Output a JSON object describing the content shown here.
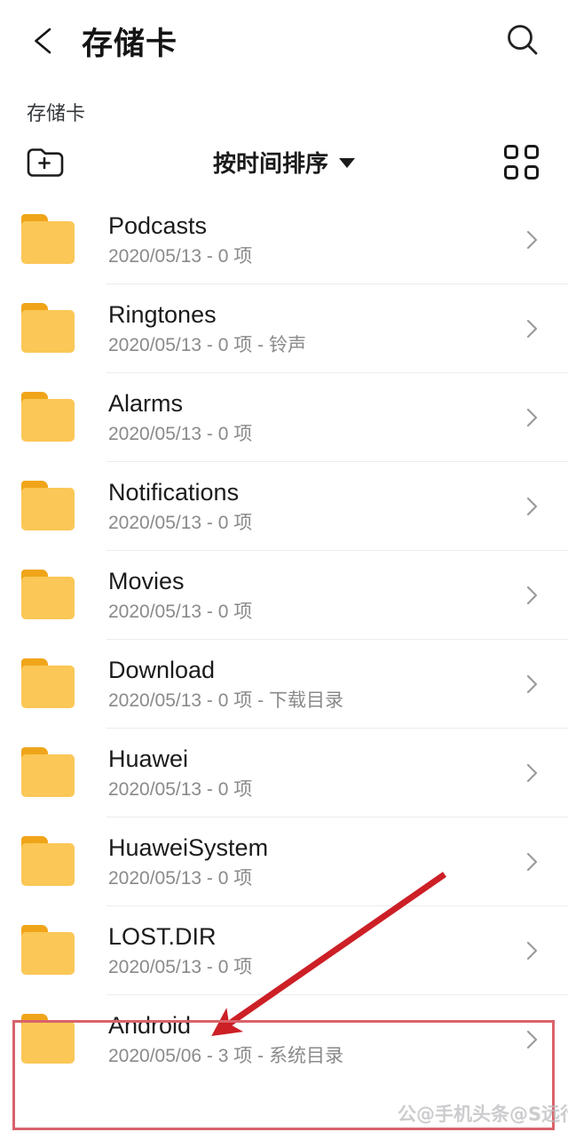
{
  "appbar": {
    "back_icon": "arrow-left-icon",
    "title": "存储卡",
    "search_icon": "search-icon"
  },
  "breadcrumb": {
    "items": [
      "存储卡"
    ]
  },
  "toolbar": {
    "new_folder_icon": "folder-plus-icon",
    "sort_label": "按时间排序",
    "sort_caret_icon": "chevron-down-icon",
    "grid_icon": "grid-view-icon"
  },
  "files": [
    {
      "name": "Podcasts",
      "meta": "2020/05/13 - 0 项",
      "icon": "folder-icon"
    },
    {
      "name": "Ringtones",
      "meta": "2020/05/13 - 0 项 - 铃声",
      "icon": "folder-icon"
    },
    {
      "name": "Alarms",
      "meta": "2020/05/13 - 0 项",
      "icon": "folder-icon"
    },
    {
      "name": "Notifications",
      "meta": "2020/05/13 - 0 项",
      "icon": "folder-icon"
    },
    {
      "name": "Movies",
      "meta": "2020/05/13 - 0 项",
      "icon": "folder-icon"
    },
    {
      "name": "Download",
      "meta": "2020/05/13 - 0 项 - 下载目录",
      "icon": "folder-icon"
    },
    {
      "name": "Huawei",
      "meta": "2020/05/13 - 0 项",
      "icon": "folder-icon"
    },
    {
      "name": "HuaweiSystem",
      "meta": "2020/05/13 - 0 项",
      "icon": "folder-icon"
    },
    {
      "name": "LOST.DIR",
      "meta": "2020/05/13 - 0 项",
      "icon": "folder-icon"
    },
    {
      "name": "Android",
      "meta": "2020/05/06 - 3 项 - 系统目录",
      "icon": "folder-icon"
    }
  ],
  "annotations": {
    "highlight_color": "#d9636b",
    "arrow_color": "#cc1f26",
    "arrow_icon": "red-arrow-annotation",
    "highlight_target": "Android",
    "watermark": "公@手机头条@S远行"
  },
  "colors": {
    "folder_body": "#fbc756",
    "folder_tab": "#f0a519",
    "text_primary": "#1b1b1b",
    "text_secondary": "#8a8a8a",
    "divider": "#ececed",
    "background": "#ffffff"
  }
}
